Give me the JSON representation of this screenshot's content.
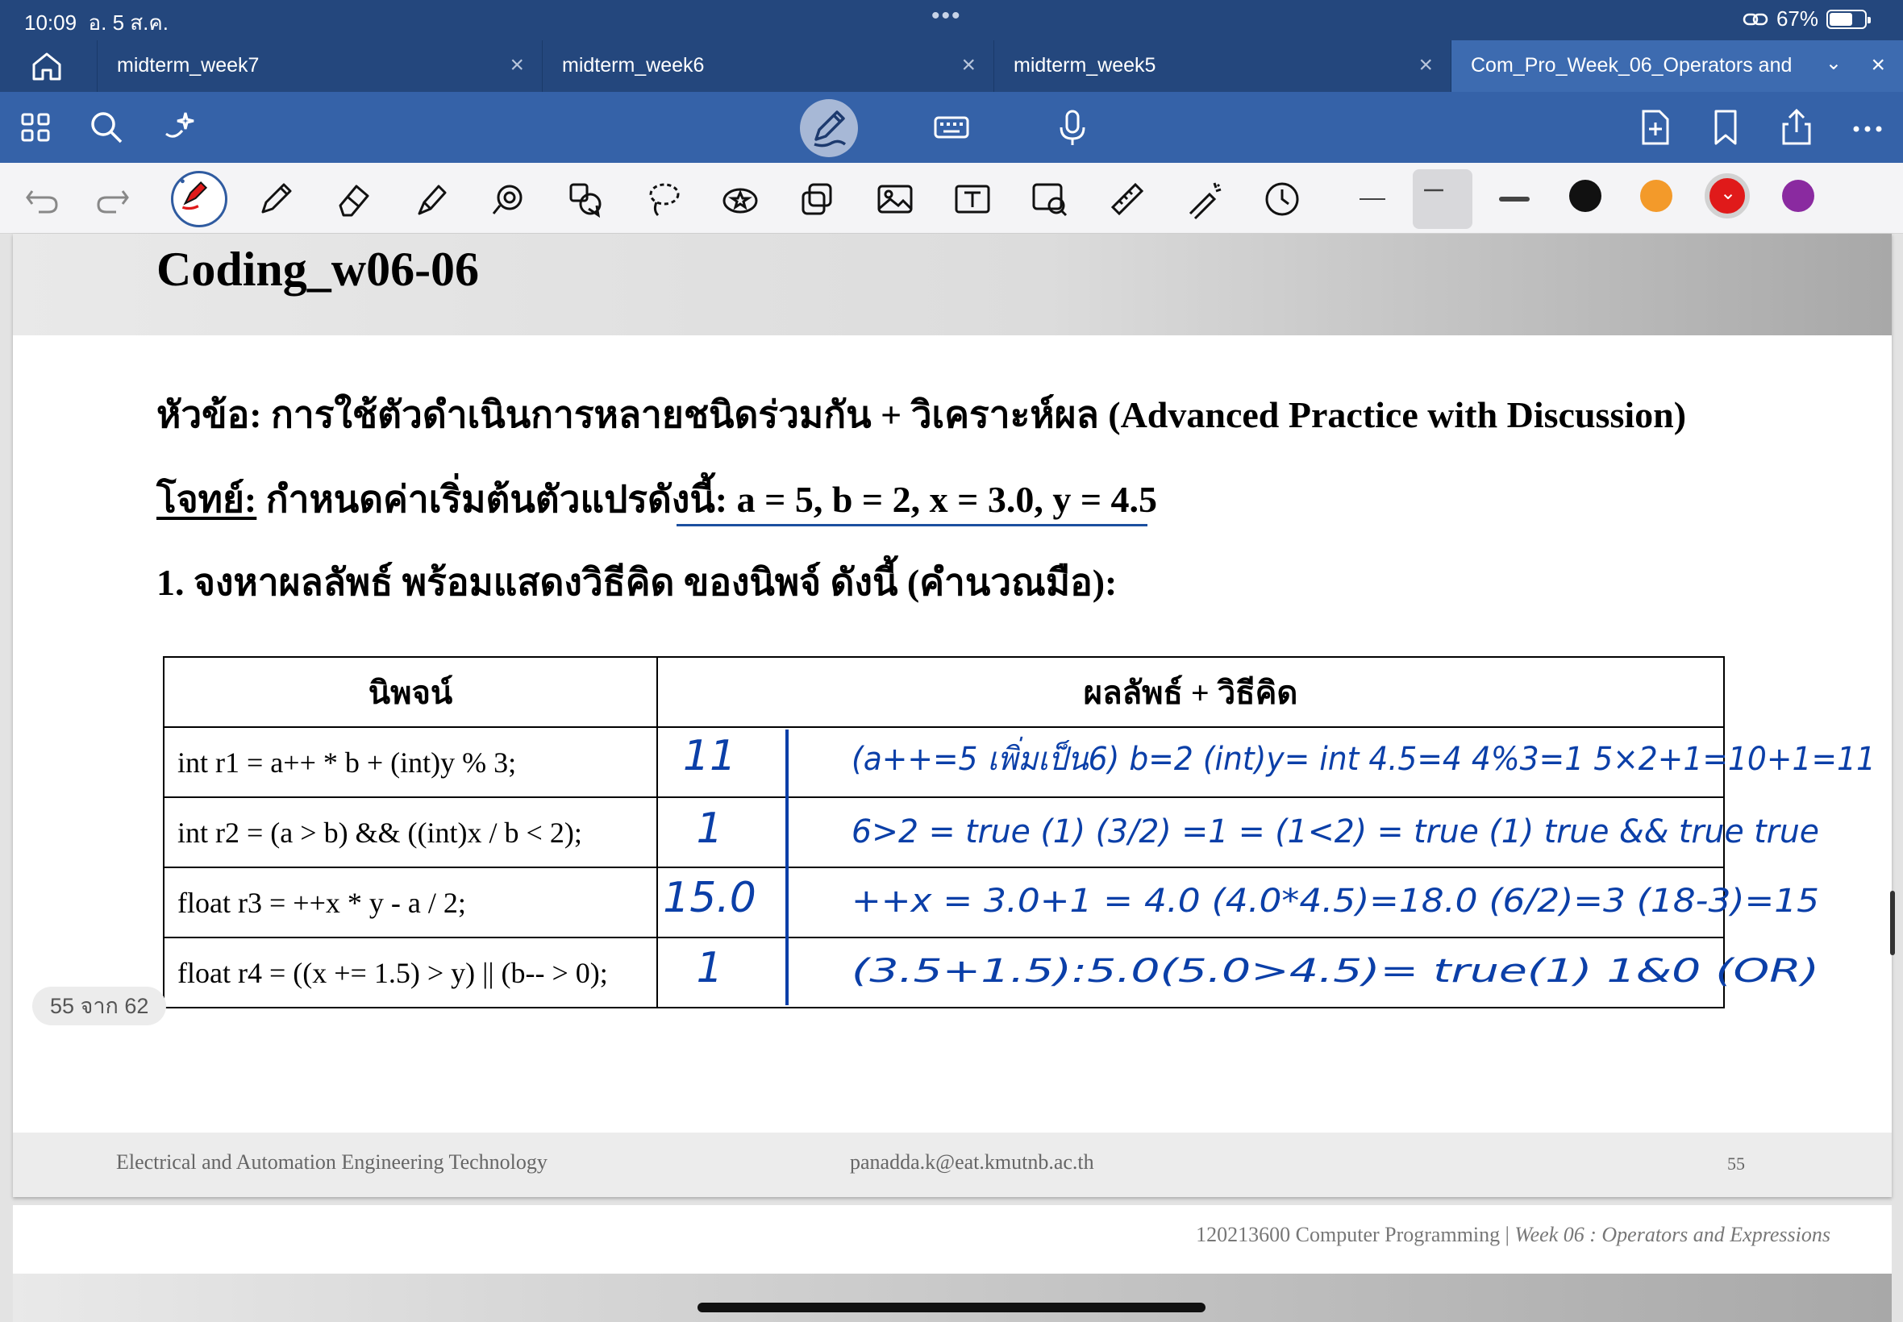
{
  "status": {
    "time": "10:09",
    "date": "อ. 5 ส.ค.",
    "battery": "67%",
    "battery_level": 0.67
  },
  "tabs": [
    {
      "label": "midterm_week7"
    },
    {
      "label": "midterm_week6"
    },
    {
      "label": "midterm_week5"
    },
    {
      "label": "Com_Pro_Week_06_Operators and..."
    }
  ],
  "colors": {
    "accent": "#24477d",
    "toolbar": "#3562a8",
    "ink": "#0b3fa8",
    "orange": "#f39a2a",
    "red": "#e01a1a",
    "purple": "#8a2aa0",
    "black": "#111111"
  },
  "slide": {
    "title": "Coding_w06-06",
    "topic_label": "หัวข้อ:",
    "topic_text": "การใช้ตัวดำเนินการหลายชนิดร่วมกัน + วิเคราะห์ผล (Advanced Practice with Discussion)",
    "problem_label": "โจทย์:",
    "problem_text": "กำหนดค่าเริ่มต้นตัวแปรดังนี้:",
    "problem_values": "a = 5, b = 2, x = 3.0, y = 4.5",
    "question": "1. จงหาผลลัพธ์ พร้อมแสดงวิธีคิด ของนิพจ์ ดังนี้ (คำนวณมือ):",
    "table": {
      "headers": [
        "นิพจน์",
        "ผลลัพธ์ + วิธีคิด"
      ],
      "rows": [
        {
          "expr": "int r1  = a++ * b + (int)y % 3;"
        },
        {
          "expr": "int r2 = (a > b) && ((int)x / b < 2);"
        },
        {
          "expr": "float r3 = ++x * y - a / 2;"
        },
        {
          "expr": "float r4 = ((x += 1.5) > y) || (b-- > 0);"
        }
      ]
    },
    "footer": {
      "dept": "Electrical and Automation Engineering Technology",
      "email": "panadda.k@eat.kmutnb.ac.th",
      "page": "55"
    }
  },
  "next": {
    "course": "120213600 Computer Programming | ",
    "course_italic": "Week 06 : Operators and Expressions"
  },
  "page_counter": "55 จาก 62",
  "handwriting": {
    "answers": [
      "11",
      "1",
      "15.0",
      "1"
    ],
    "work": [
      "(a++=5 เพิ่มเป็น6) b=2  (int)y= int 4.5=4  4%3=1   5×2+1=10+1=11",
      "6>2 = true (1) (3/2) =1 = (1<2) = true (1) true && true  true",
      "++x = 3.0+1 = 4.0 (4.0*4.5)=18.0 (6/2)=3 (18-3)=15",
      "(3.5+1.5):5.0(5.0>4.5)= true(1) 1&0 (OR)"
    ]
  }
}
